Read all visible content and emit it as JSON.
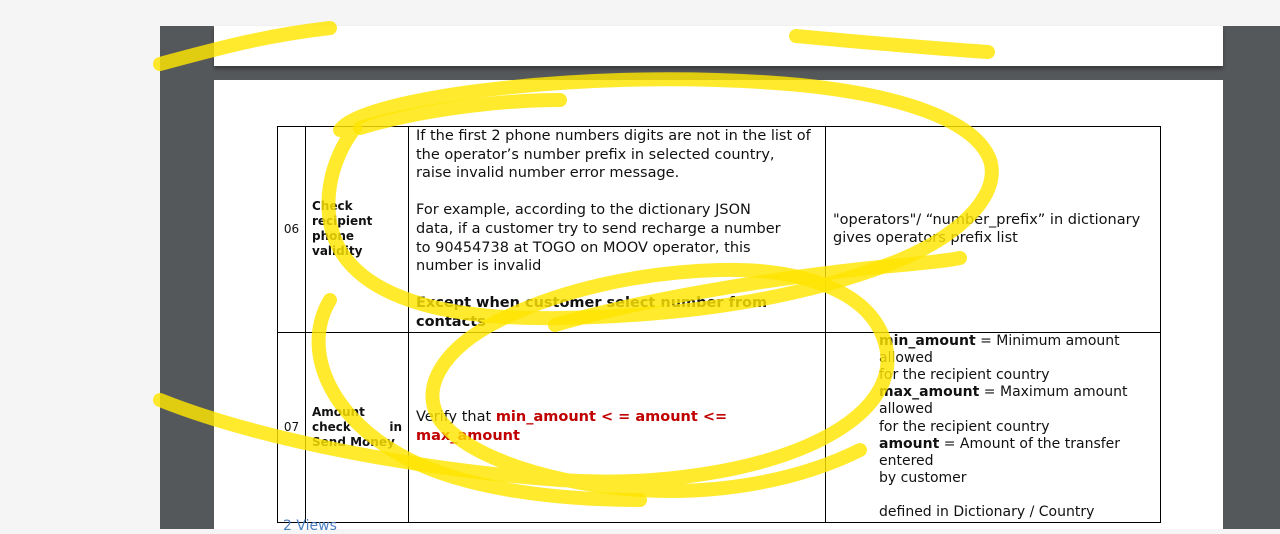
{
  "table": {
    "rows": [
      {
        "id": "06",
        "name_lines": [
          "Check",
          "recipient",
          "phone",
          "validity"
        ],
        "desc_lines": [
          "If the first 2 phone numbers digits are not in the list of",
          "the operator’s number prefix in selected country,",
          "raise invalid number error message.",
          "For example, according to the dictionary JSON",
          "data, if a customer try to send recharge a number",
          "to  90454738 at TOGO on MOOV operator, this",
          "number is invalid"
        ],
        "desc_bold": "Except when customer select number from contacts",
        "ref_lines": [
          "\"operators\"/ “number_prefix” in dictionary",
          "gives operators prefix list"
        ]
      },
      {
        "id": "07",
        "name_lines": [
          "Amount",
          "check",
          "in",
          "Send Money"
        ],
        "desc_prefix": "Verify that ",
        "desc_formula": "min_amount < = amount <= max_amount",
        "ref": [
          {
            "term": "min_amount",
            "text": " = Minimum amount allowed"
          },
          {
            "text": "for the recipient country"
          },
          {
            "term": "max_amount",
            "text": " = Maximum amount allowed"
          },
          {
            "text": "for the recipient country"
          },
          {
            "term": "amount",
            "text": " = Amount of the transfer entered"
          },
          {
            "text": "by customer"
          }
        ],
        "ref_footer": "defined in Dictionary / Country"
      }
    ]
  },
  "next_section": "2   Views",
  "colors": {
    "highlighter": "#ffe500",
    "viewer_bg": "#55585b",
    "formula_red": "#c00000",
    "link_blue": "#4a7fc1"
  }
}
